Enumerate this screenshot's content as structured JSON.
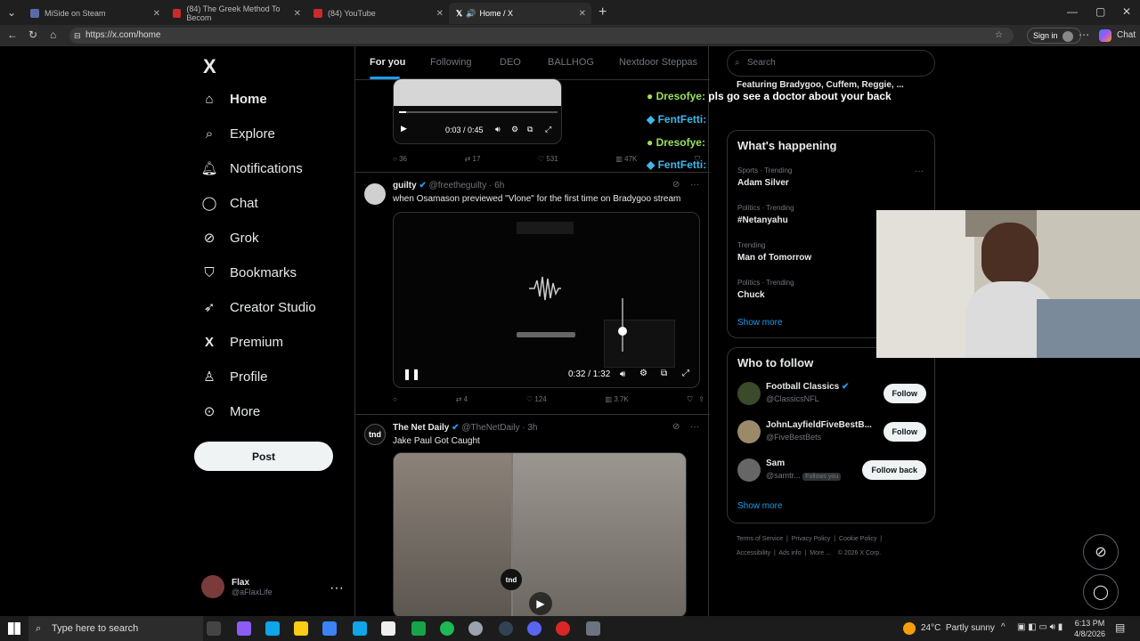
{
  "browser": {
    "tabs": [
      {
        "title": "MiSide on Steam",
        "color": "#5a6aa8"
      },
      {
        "title": "(84) The Greek Method To Becom",
        "color": "#cc2a2a"
      },
      {
        "title": "(84) YouTube",
        "color": "#cc2a2a"
      },
      {
        "title": "Home / X",
        "color": "#ffffff"
      }
    ],
    "url": "https://x.com/home",
    "sign_in": "Sign in",
    "chat": "Chat"
  },
  "x": {
    "logo": "X",
    "nav": [
      "Home",
      "Explore",
      "Notifications",
      "Chat",
      "Grok",
      "Bookmarks",
      "Creator Studio",
      "Premium",
      "Profile",
      "More"
    ],
    "post_label": "Post",
    "account": {
      "name": "Flax",
      "handle": "@aFlaxLife"
    },
    "feed_tabs": [
      "For you",
      "Following",
      "DEO",
      "BALLHOG",
      "Nextdoor Steppas"
    ],
    "tweets": [
      {
        "time": "0:03 / 0:45",
        "stats": {
          "replies": "36",
          "reposts": "17",
          "likes": "531",
          "views": "47K"
        }
      },
      {
        "name": "guilty",
        "handle": "@freetheguilty",
        "age": "6h",
        "text": "when Osamason previewed \"Vlone\" for the first time on Bradygoo stream",
        "time": "0:32 / 1:32",
        "stats": {
          "replies": "",
          "reposts": "4",
          "likes": "124",
          "views": "3.7K"
        }
      },
      {
        "name": "The Net Daily",
        "handle": "@TheNetDaily",
        "age": "3h",
        "avatar_text": "tnd",
        "text": "Jake Paul Got Caught"
      }
    ],
    "search_placeholder": "Search",
    "top_card_text": "Featuring Bradygoo, Cuffem, Reggie, ...",
    "happening": {
      "title": "What's happening",
      "trends": [
        {
          "cat": "Sports · Trending",
          "topic": "Adam Silver"
        },
        {
          "cat": "Politics · Trending",
          "topic": "#Netanyahu"
        },
        {
          "cat": "Trending",
          "topic": "Man of Tomorrow"
        },
        {
          "cat": "Politics · Trending",
          "topic": "Chuck"
        }
      ],
      "show_more": "Show more"
    },
    "who_to_follow": {
      "title": "Who to follow",
      "people": [
        {
          "name": "Football Classics",
          "handle": "@ClassicsNFL",
          "button": "Follow"
        },
        {
          "name": "JohnLayfieldFiveBestB...",
          "handle": "@FiveBestBets",
          "button": "Follow"
        },
        {
          "name": "Sam",
          "handle": "@samtr...",
          "badge": "Follows you",
          "button": "Follow back"
        }
      ],
      "show_more": "Show more"
    },
    "footer": [
      "Terms of Service",
      "Privacy Policy",
      "Cookie Policy",
      "Accessibility",
      "Ads info",
      "More ...",
      "© 2026 X Corp."
    ]
  },
  "overlay_chat": [
    {
      "user": "Dresofye:",
      "msg": "pls go see a doctor about your back"
    },
    {
      "user": "FentFetti:",
      "msg": ""
    },
    {
      "user": "Dresofye:",
      "msg": ""
    },
    {
      "user": "FentFetti:",
      "msg": ""
    }
  ],
  "taskbar": {
    "search": "Type here to search",
    "weather": "24°C  Partly sunny",
    "time": "6:13 PM",
    "date": "4/8/2026"
  }
}
